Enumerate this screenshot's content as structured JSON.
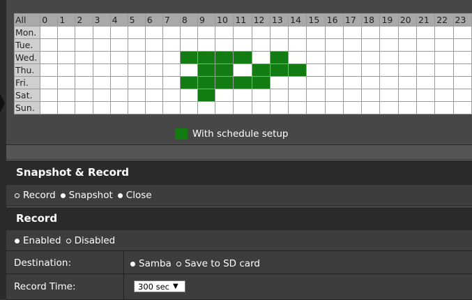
{
  "schedule": {
    "all_label": "All",
    "hours": [
      "0",
      "1",
      "2",
      "3",
      "4",
      "5",
      "6",
      "7",
      "8",
      "9",
      "10",
      "11",
      "12",
      "13",
      "14",
      "15",
      "16",
      "17",
      "18",
      "19",
      "20",
      "21",
      "22",
      "23"
    ],
    "days": [
      {
        "label": "Mon.",
        "on": []
      },
      {
        "label": "Tue.",
        "on": []
      },
      {
        "label": "Wed.",
        "on": [
          8,
          9,
          10,
          11,
          13
        ]
      },
      {
        "label": "Thu.",
        "on": [
          9,
          10,
          12,
          13,
          14
        ]
      },
      {
        "label": "Fri.",
        "on": [
          8,
          9,
          10,
          11,
          12
        ]
      },
      {
        "label": "Sat.",
        "on": [
          9
        ]
      },
      {
        "label": "Sun.",
        "on": []
      }
    ],
    "legend_label": "With schedule setup",
    "on_color": "#127b12"
  },
  "snapshot_record": {
    "title": "Snapshot & Record",
    "options": [
      {
        "label": "Record",
        "selected": true
      },
      {
        "label": "Snapshot",
        "selected": false
      },
      {
        "label": "Close",
        "selected": false
      }
    ]
  },
  "record": {
    "title": "Record",
    "options": [
      {
        "label": "Enabled",
        "selected": false
      },
      {
        "label": "Disabled",
        "selected": true
      }
    ],
    "destination": {
      "label": "Destination:",
      "options": [
        {
          "label": "Samba",
          "selected": false
        },
        {
          "label": "Save to SD card",
          "selected": true
        }
      ]
    },
    "record_time": {
      "label": "Record Time:",
      "value": "300 sec"
    }
  }
}
